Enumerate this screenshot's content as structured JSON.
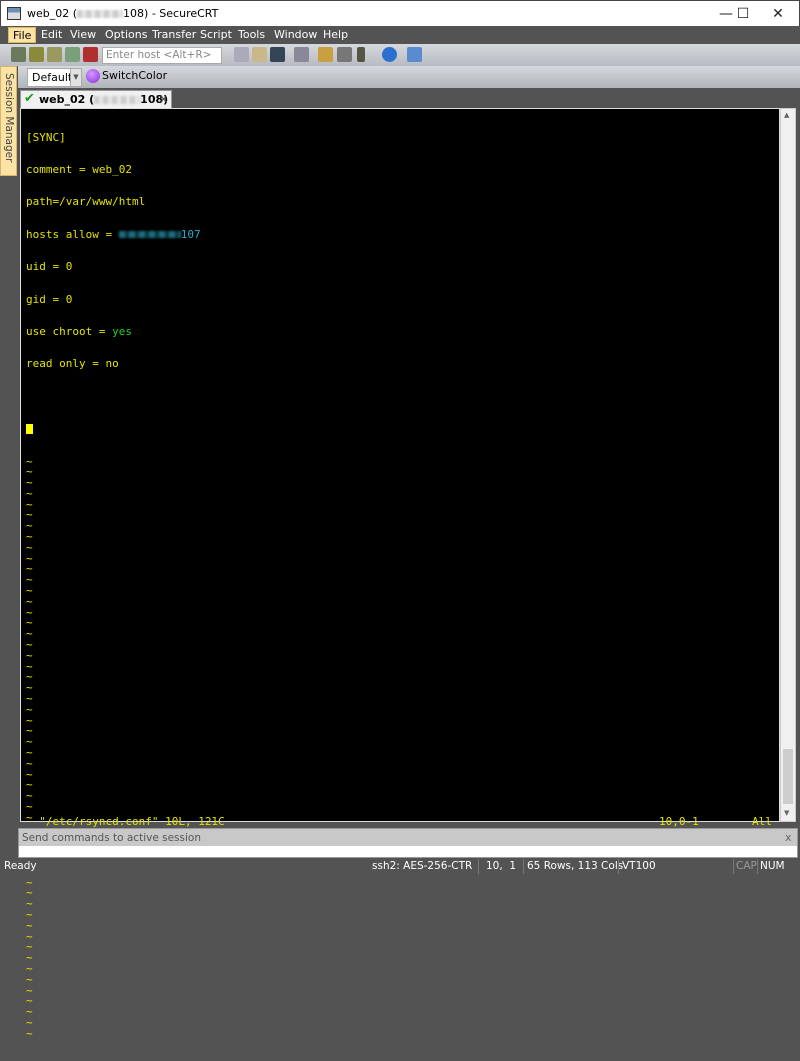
{
  "window": {
    "title_prefix": "web_02 (",
    "title_suffix": "108) - SecureCRT",
    "minimize": "—",
    "maximize": "☐",
    "close": "✕"
  },
  "menu": [
    "File",
    "Edit",
    "View",
    "Options",
    "Transfer",
    "Script",
    "Tools",
    "Window",
    "Help"
  ],
  "toolbar": {
    "host_placeholder": "Enter host <Alt+R>"
  },
  "session_bar": {
    "selected": "Default",
    "switch_color": "SwitchColor"
  },
  "side_panel": {
    "label": "Session Manager"
  },
  "tab": {
    "label_prefix": "web_02 (",
    "label_suffix": "108)",
    "close": "✕"
  },
  "terminal": {
    "lines": [
      {
        "text": "[SYNC]"
      },
      {
        "text": "comment = web_02"
      },
      {
        "text": "path=/var/www/html"
      },
      {
        "text": "hosts allow = ",
        "ip_suffix": "107"
      },
      {
        "text": "uid = 0"
      },
      {
        "text": "gid = 0"
      },
      {
        "text": "use chroot = ",
        "value": "yes"
      },
      {
        "text": "read only = no"
      }
    ],
    "tilde": "~",
    "tilde_rows": 54,
    "status_file": "\"/etc/rsyncd.conf\" 10L, 121C",
    "status_pos": "10,0-1",
    "status_scroll": "All"
  },
  "command_window": {
    "placeholder": "Send commands to active session",
    "close": "x"
  },
  "statusbar": {
    "ready": "Ready",
    "cipher": "ssh2: AES-256-CTR",
    "cursor": "10,  1",
    "size": "65 Rows, 113 Cols",
    "emulation": "VT100",
    "cap": "CAP",
    "num": "NUM"
  }
}
